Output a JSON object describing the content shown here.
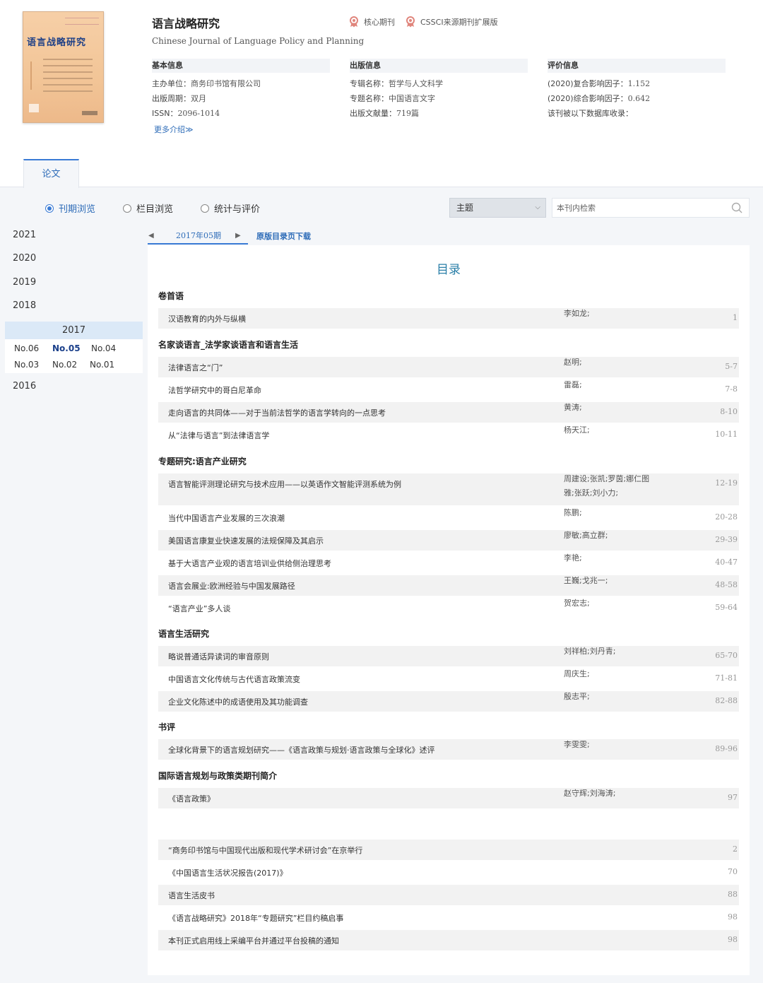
{
  "journal": {
    "title": "语言战略研究",
    "title_en": "Chinese Journal of Language Policy and Planning",
    "badge_core": "核心期刊",
    "badge_cssci": "CSSCI来源期刊扩展版",
    "basic": {
      "head": "基本信息",
      "sponsor_label": "主办单位：",
      "sponsor": "商务印书馆有限公司",
      "cycle_label": "出版周期：",
      "cycle": "双月",
      "issn_label": "ISSN：",
      "issn": "2096-1014",
      "more": "更多介绍≫"
    },
    "pub": {
      "head": "出版信息",
      "series_label": "专辑名称：",
      "series": "哲学与人文科学",
      "topic_label": "专题名称：",
      "topic": "中国语言文字",
      "count_label": "出版文献量：",
      "count": "719篇"
    },
    "eval": {
      "head": "评价信息",
      "composite_label": "(2020)复合影响因子：",
      "composite": "1.152",
      "overall_label": "(2020)综合影响因子：",
      "overall": "0.642",
      "db_label": "该刊被以下数据库收录："
    },
    "cover": {
      "title": "语言战略研究",
      "color": "#f2c597"
    }
  },
  "tabs": {
    "papers": "论文"
  },
  "toolbar": {
    "radio_issue": "刊期浏览",
    "radio_column": "栏目浏览",
    "radio_stats": "统计与评价",
    "select_value": "主题",
    "search_placeholder": "本刊内检索"
  },
  "years": {
    "y2021": "2021",
    "y2020": "2020",
    "y2019": "2019",
    "y2018": "2018",
    "y2017": "2017",
    "y2016": "2016",
    "issues": [
      "No.06",
      "No.05",
      "No.04",
      "No.03",
      "No.02",
      "No.01"
    ]
  },
  "issue_nav": {
    "prev": "◀",
    "current": "2017年05期",
    "next": "▶",
    "download": "原版目录页下载"
  },
  "toc": {
    "title": "目录",
    "sections": [
      {
        "title": "卷首语",
        "items": [
          {
            "title": "汉语教育的内外与纵横",
            "authors": "李如龙;",
            "pages": "1"
          }
        ]
      },
      {
        "title": "名家谈语言_法学家谈语言和语言生活",
        "items": [
          {
            "title": "法律语言之“门”",
            "authors": "赵明;",
            "pages": "5-7"
          },
          {
            "title": "法哲学研究中的哥白尼革命",
            "authors": "雷磊;",
            "pages": "7-8"
          },
          {
            "title": "走向语言的共同体——对于当前法哲学的语言学转向的一点思考",
            "authors": "黄涛;",
            "pages": "8-10"
          },
          {
            "title": "从“法律与语言”到法律语言学",
            "authors": "杨天江;",
            "pages": "10-11"
          }
        ]
      },
      {
        "title": "专题研究:语言产业研究",
        "items": [
          {
            "title": "语言智能评测理论研究与技术应用——以英语作文智能评测系统为例",
            "authors": "周建设;张凯;罗茵;娜仁图雅;张跃;刘小力;",
            "pages": "12-19"
          },
          {
            "title": "当代中国语言产业发展的三次浪潮",
            "authors": "陈鹏;",
            "pages": "20-28"
          },
          {
            "title": "美国语言康复业快速发展的法规保障及其启示",
            "authors": "廖敏;高立群;",
            "pages": "29-39"
          },
          {
            "title": "基于大语言产业观的语言培训业供给侧治理思考",
            "authors": "李艳;",
            "pages": "40-47"
          },
          {
            "title": "语言会展业:欧洲经验与中国发展路径",
            "authors": "王巍;戈兆一;",
            "pages": "48-58"
          },
          {
            "title": "“语言产业”多人谈",
            "authors": "贺宏志;",
            "pages": "59-64"
          }
        ]
      },
      {
        "title": "语言生活研究",
        "items": [
          {
            "title": "略说普通话异读词的审音原则",
            "authors": "刘祥柏;刘丹青;",
            "pages": "65-70"
          },
          {
            "title": "中国语言文化传统与古代语言政策流变",
            "authors": "周庆生;",
            "pages": "71-81"
          },
          {
            "title": "企业文化陈述中的成语使用及其功能调查",
            "authors": "殷志平;",
            "pages": "82-88"
          }
        ]
      },
      {
        "title": "书评",
        "items": [
          {
            "title": "全球化背景下的语言规划研究——《语言政策与规划·语言政策与全球化》述评",
            "authors": "李雯雯;",
            "pages": "89-96"
          }
        ]
      },
      {
        "title": "国际语言规划与政策类期刊简介",
        "items": [
          {
            "title": "《语言政策》",
            "authors": "赵守辉;刘海涛;",
            "pages": "97"
          }
        ]
      },
      {
        "title": "",
        "items": [
          {
            "title": "“商务印书馆与中国现代出版和现代学术研讨会”在京举行",
            "authors": "",
            "pages": "2"
          },
          {
            "title": "《中国语言生活状况报告(2017)》",
            "authors": "",
            "pages": "70"
          },
          {
            "title": "语言生活皮书",
            "authors": "",
            "pages": "88"
          },
          {
            "title": "《语言战略研究》2018年“专题研究”栏目约稿启事",
            "authors": "",
            "pages": "98"
          },
          {
            "title": "本刊正式启用线上采编平台并通过平台投稿的通知",
            "authors": "",
            "pages": "98"
          }
        ]
      }
    ]
  },
  "colors": {
    "accent": "#3a7bd5",
    "link": "#2e6cb8",
    "toc_title": "#2a7fa8",
    "badge": "#e0857c"
  }
}
